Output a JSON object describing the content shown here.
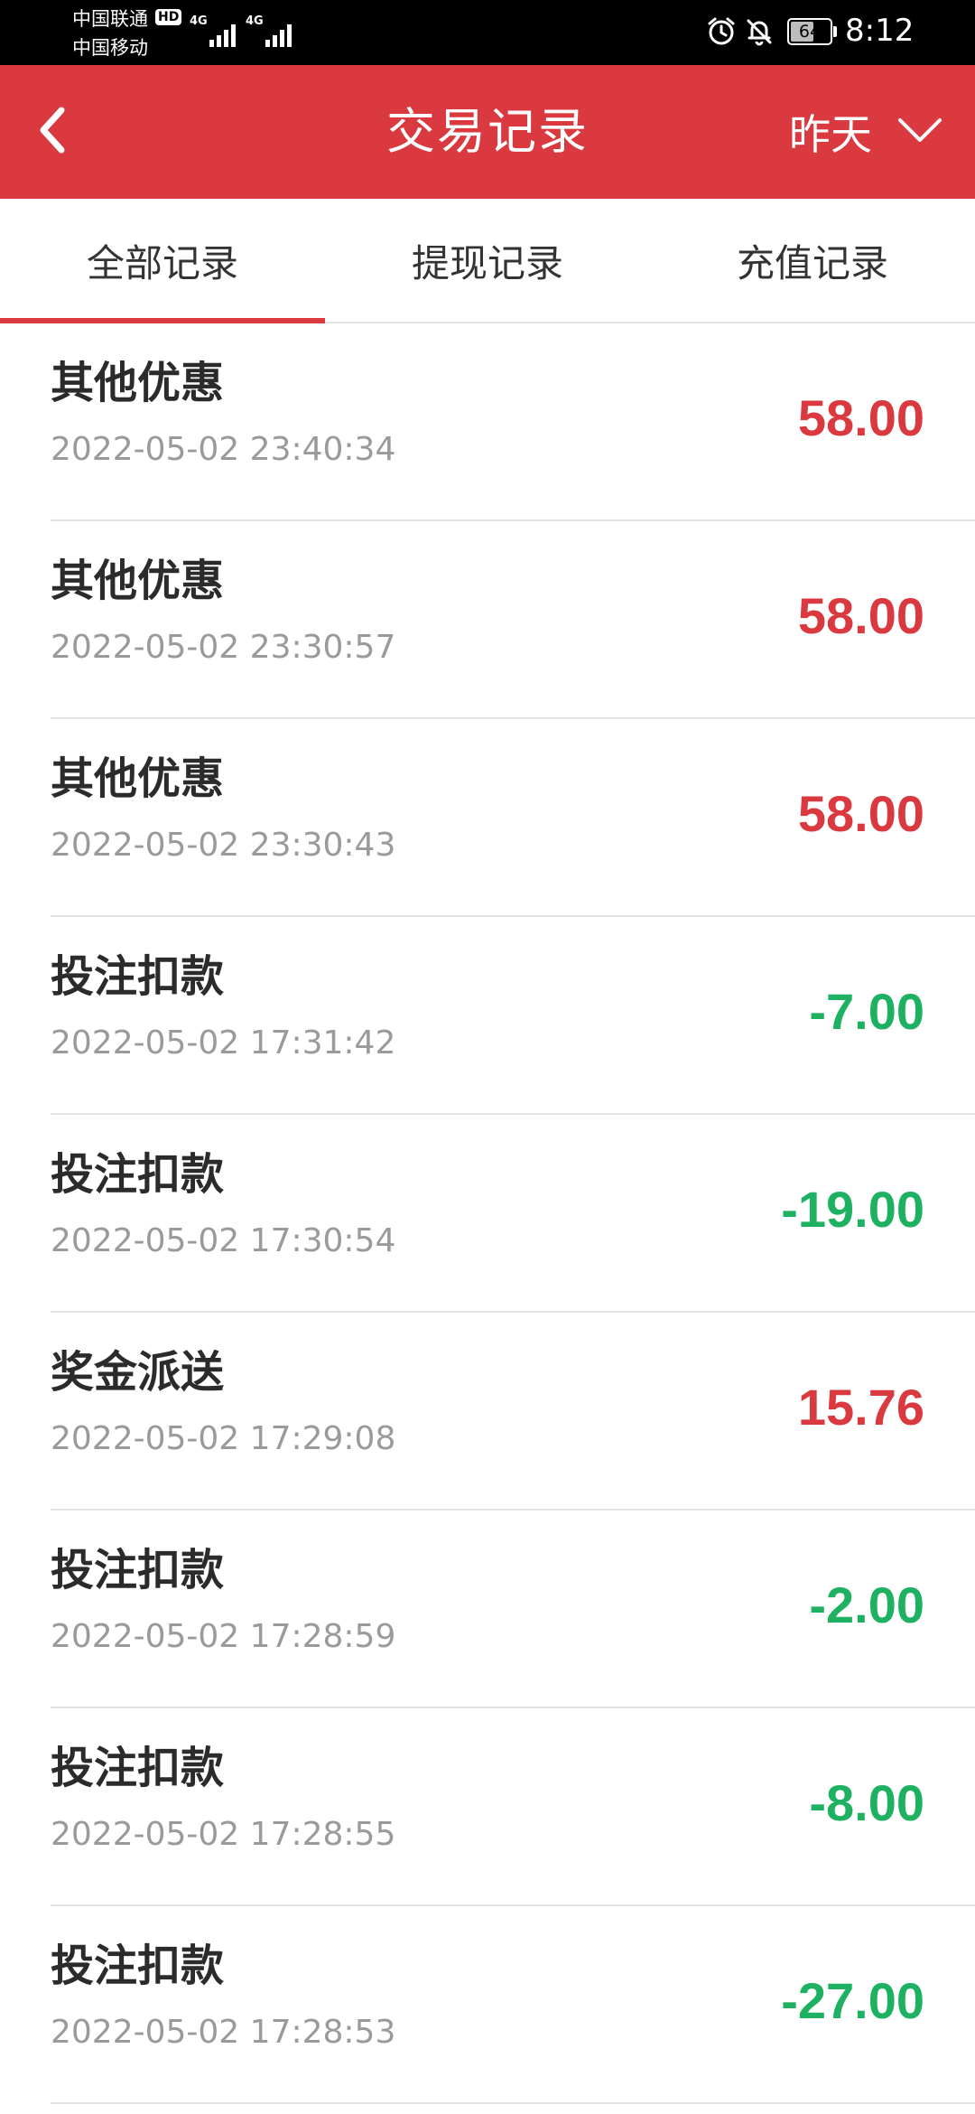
{
  "status_bar": {
    "carrier_1": "中国联通",
    "carrier_1_badge": "HD",
    "carrier_2": "中国移动",
    "network_1": "4G",
    "network_2": "4G",
    "battery_level": "64",
    "time": "8:12",
    "icons": [
      "alarm-icon",
      "bell-muted-icon"
    ]
  },
  "header": {
    "title": "交易记录",
    "back_icon": "chevron-left-icon",
    "date_filter": "昨天",
    "date_filter_icon": "chevron-down-icon"
  },
  "tabs": [
    {
      "label": "全部记录",
      "active": true
    },
    {
      "label": "提现记录",
      "active": false
    },
    {
      "label": "充值记录",
      "active": false
    }
  ],
  "colors": {
    "accent": "#d9393f",
    "positive_amount": "#d9393f",
    "negative_amount": "#1fb162"
  },
  "records": [
    {
      "title": "其他优惠",
      "time": "2022-05-02 23:40:34",
      "amount": "58.00",
      "kind": "income"
    },
    {
      "title": "其他优惠",
      "time": "2022-05-02 23:30:57",
      "amount": "58.00",
      "kind": "income"
    },
    {
      "title": "其他优惠",
      "time": "2022-05-02 23:30:43",
      "amount": "58.00",
      "kind": "income"
    },
    {
      "title": "投注扣款",
      "time": "2022-05-02 17:31:42",
      "amount": "-7.00",
      "kind": "expense"
    },
    {
      "title": "投注扣款",
      "time": "2022-05-02 17:30:54",
      "amount": "-19.00",
      "kind": "expense"
    },
    {
      "title": "奖金派送",
      "time": "2022-05-02 17:29:08",
      "amount": "15.76",
      "kind": "income"
    },
    {
      "title": "投注扣款",
      "time": "2022-05-02 17:28:59",
      "amount": "-2.00",
      "kind": "expense"
    },
    {
      "title": "投注扣款",
      "time": "2022-05-02 17:28:55",
      "amount": "-8.00",
      "kind": "expense"
    },
    {
      "title": "投注扣款",
      "time": "2022-05-02 17:28:53",
      "amount": "-27.00",
      "kind": "expense"
    }
  ]
}
